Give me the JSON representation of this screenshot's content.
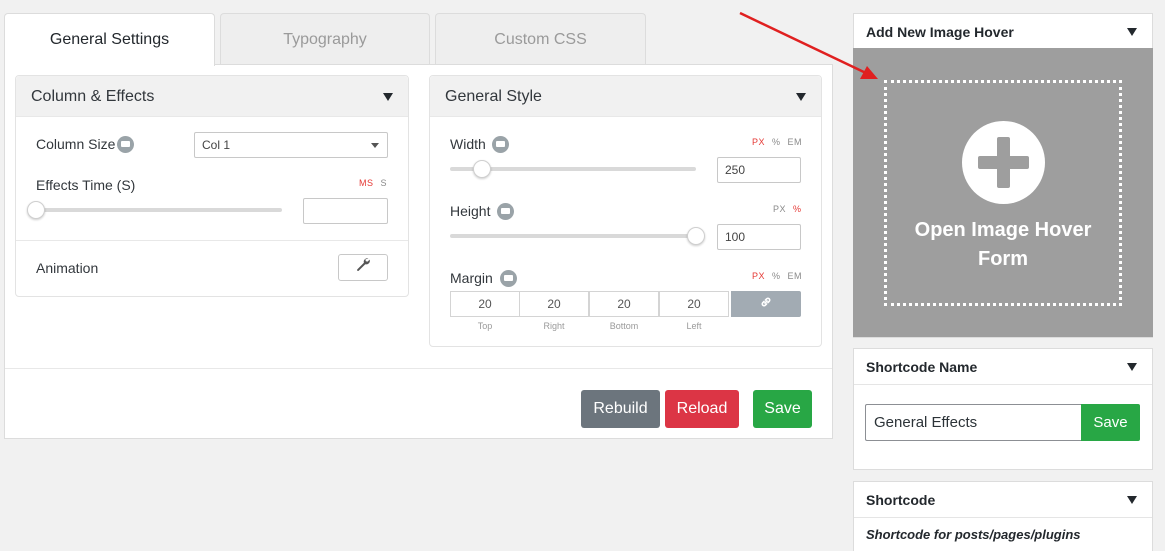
{
  "tabs": [
    {
      "label": "General Settings",
      "active": true
    },
    {
      "label": "Typography",
      "active": false
    },
    {
      "label": "Custom CSS",
      "active": false
    }
  ],
  "column_effects": {
    "title": "Column & Effects",
    "column_size_label": "Column Size",
    "column_size_value": "Col 1",
    "effects_time_label": "Effects Time (S)",
    "effects_time_units": [
      "MS",
      "S"
    ],
    "effects_time_active_unit": "MS",
    "effects_time_slider": 0,
    "effects_time_value": "",
    "animation_label": "Animation"
  },
  "general_style": {
    "title": "General Style",
    "width": {
      "label": "Width",
      "units": [
        "PX",
        "%",
        "EM"
      ],
      "active_unit": "PX",
      "value": "250",
      "slider": 0.05
    },
    "height": {
      "label": "Height",
      "units": [
        "PX",
        "%"
      ],
      "active_unit": "%",
      "value": "100",
      "slider": 1.0
    },
    "margin": {
      "label": "Margin",
      "units": [
        "PX",
        "%",
        "EM"
      ],
      "active_unit": "PX",
      "values": [
        "20",
        "20",
        "20",
        "20"
      ],
      "sides": [
        "Top",
        "Right",
        "Bottom",
        "Left"
      ]
    }
  },
  "actions": {
    "rebuild": "Rebuild",
    "reload": "Reload",
    "save": "Save"
  },
  "sidebar": {
    "add_new": {
      "title": "Add New Image Hover",
      "open_line1": "Open Image Hover",
      "open_line2": "Form"
    },
    "shortcode_name": {
      "title": "Shortcode Name",
      "value": "General Effects",
      "save": "Save"
    },
    "shortcode": {
      "title": "Shortcode",
      "subtitle": "Shortcode for posts/pages/plugins"
    }
  },
  "colors": {
    "rebuild": "#6c757d",
    "reload": "#dc3545",
    "save": "#28a745",
    "annotation_arrow": "#e02020"
  }
}
